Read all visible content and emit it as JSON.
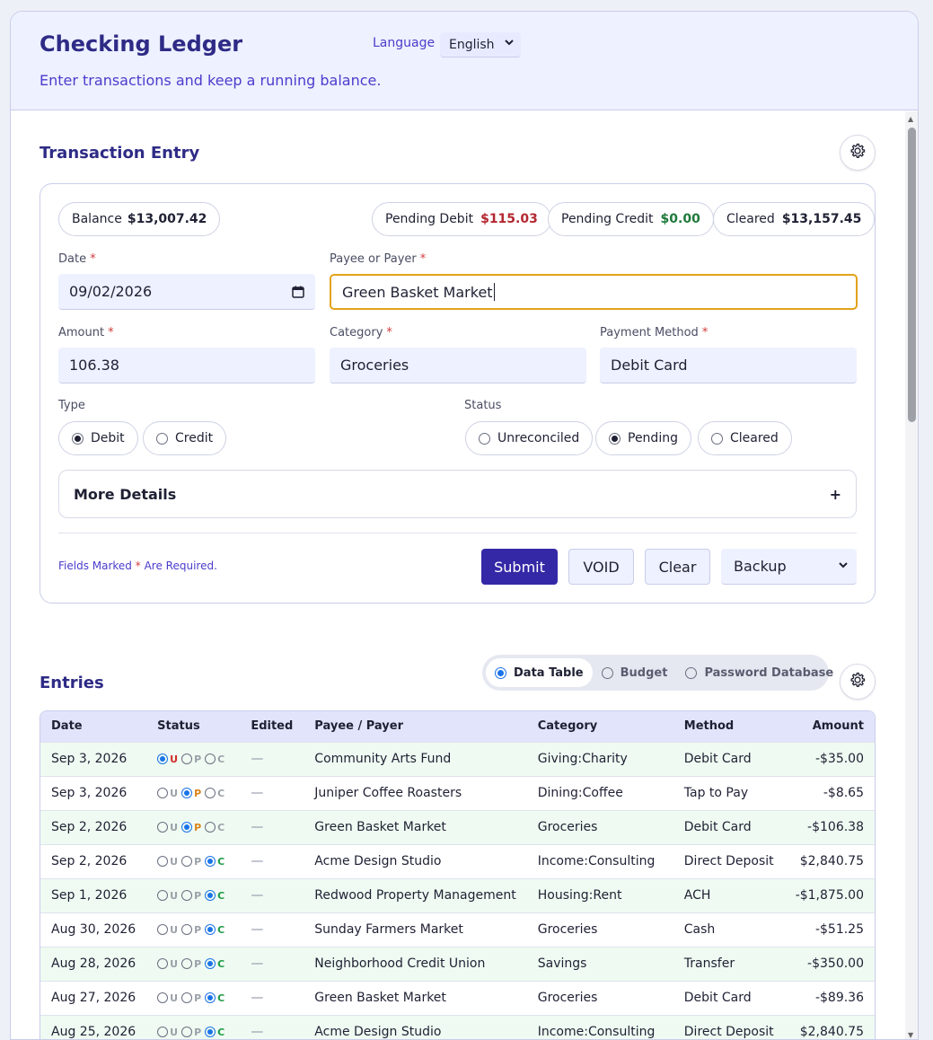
{
  "app": {
    "title": "Checking Ledger",
    "subtitle": "Enter transactions and keep a running balance.",
    "language_label": "Language",
    "language_value": "English"
  },
  "entry": {
    "title": "Transaction Entry",
    "summary": {
      "balance_label": "Balance",
      "balance_value": "$13,007.42",
      "pending_debit_label": "Pending Debit",
      "pending_debit_value": "$115.03",
      "pending_credit_label": "Pending Credit",
      "pending_credit_value": "$0.00",
      "cleared_label": "Cleared",
      "cleared_value": "$13,157.45"
    },
    "fields": {
      "date_label": "Date",
      "date_value": "09/02/2026",
      "payee_label": "Payee or Payer",
      "payee_value": "Green Basket Market",
      "amount_label": "Amount",
      "amount_value": "106.38",
      "category_label": "Category",
      "category_value": "Groceries",
      "method_label": "Payment Method",
      "method_value": "Debit Card",
      "required_mark": "*"
    },
    "type": {
      "label": "Type",
      "options": [
        "Debit",
        "Credit"
      ],
      "selected": "Debit"
    },
    "status": {
      "label": "Status",
      "options": [
        "Unreconciled",
        "Pending",
        "Cleared"
      ],
      "selected": "Pending"
    },
    "more_details": "More Details",
    "more_details_icon": "+",
    "required_note_prefix": "Fields Marked",
    "required_note_star": "*",
    "required_note_suffix": "Are Required.",
    "buttons": {
      "submit": "Submit",
      "void": "VOID",
      "clear": "Clear",
      "backup": "Backup"
    }
  },
  "entries": {
    "title": "Entries",
    "views": [
      "Data Table",
      "Budget",
      "Password Database"
    ],
    "selected_view": "Data Table",
    "columns": [
      "Date",
      "Status",
      "Edited",
      "Payee / Payer",
      "Category",
      "Method",
      "Amount"
    ],
    "status_letters": [
      "U",
      "P",
      "C"
    ],
    "rows": [
      {
        "date": "Sep 3, 2026",
        "status": "U",
        "edited": "—",
        "payee": "Community Arts Fund",
        "category": "Giving:Charity",
        "method": "Debit Card",
        "amount": "-$35.00"
      },
      {
        "date": "Sep 3, 2026",
        "status": "P",
        "edited": "—",
        "payee": "Juniper Coffee Roasters",
        "category": "Dining:Coffee",
        "method": "Tap to Pay",
        "amount": "-$8.65"
      },
      {
        "date": "Sep 2, 2026",
        "status": "P",
        "edited": "—",
        "payee": "Green Basket Market",
        "category": "Groceries",
        "method": "Debit Card",
        "amount": "-$106.38"
      },
      {
        "date": "Sep 2, 2026",
        "status": "C",
        "edited": "—",
        "payee": "Acme Design Studio",
        "category": "Income:Consulting",
        "method": "Direct Deposit",
        "amount": "$2,840.75"
      },
      {
        "date": "Sep 1, 2026",
        "status": "C",
        "edited": "—",
        "payee": "Redwood Property Management",
        "category": "Housing:Rent",
        "method": "ACH",
        "amount": "-$1,875.00"
      },
      {
        "date": "Aug 30, 2026",
        "status": "C",
        "edited": "—",
        "payee": "Sunday Farmers Market",
        "category": "Groceries",
        "method": "Cash",
        "amount": "-$51.25"
      },
      {
        "date": "Aug 28, 2026",
        "status": "C",
        "edited": "—",
        "payee": "Neighborhood Credit Union",
        "category": "Savings",
        "method": "Transfer",
        "amount": "-$350.00"
      },
      {
        "date": "Aug 27, 2026",
        "status": "C",
        "edited": "—",
        "payee": "Green Basket Market",
        "category": "Groceries",
        "method": "Debit Card",
        "amount": "-$89.36"
      },
      {
        "date": "Aug 25, 2026",
        "status": "C",
        "edited": "—",
        "payee": "Acme Design Studio",
        "category": "Income:Consulting",
        "method": "Direct Deposit",
        "amount": "$2,840.75"
      }
    ]
  },
  "colors": {
    "accent": "#3528a6",
    "title": "#2e2b86",
    "debit_red": "#b3262f",
    "credit_green": "#1e7a3a",
    "focus_border": "#e3a21a"
  },
  "icons": {
    "settings": "gear-icon",
    "calendar": "calendar-icon",
    "dropdown": "chevron-down-icon"
  }
}
